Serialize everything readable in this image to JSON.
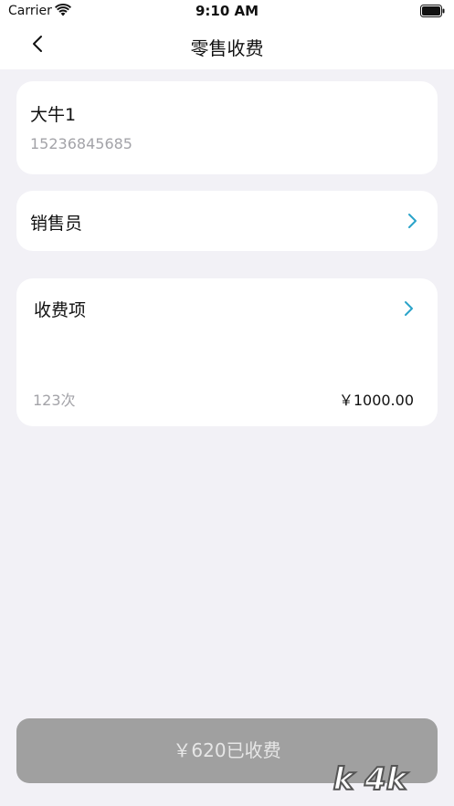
{
  "status_bar": {
    "carrier": "Carrier",
    "time": "9:10 AM",
    "wifi_icon": "wifi-icon",
    "battery_icon": "battery-icon"
  },
  "nav": {
    "title": "零售收费",
    "back_icon": "chevron-left-icon"
  },
  "customer": {
    "name": "大牛1",
    "phone": "15236845685"
  },
  "salesperson": {
    "label": "销售员",
    "icon": "chevron-right-icon"
  },
  "charge_items": {
    "label": "收费项",
    "count": "123次",
    "price": "￥1000.00",
    "icon": "chevron-right-icon"
  },
  "pay_button": {
    "label": "￥620已收费"
  },
  "watermark": {
    "text": "k 4k"
  },
  "colors": {
    "background": "#f2f1f6",
    "card": "#ffffff",
    "accent_chevron": "#2aa3c9",
    "secondary_text": "#a3a3a8",
    "button_disabled": "#a0a0a0"
  }
}
